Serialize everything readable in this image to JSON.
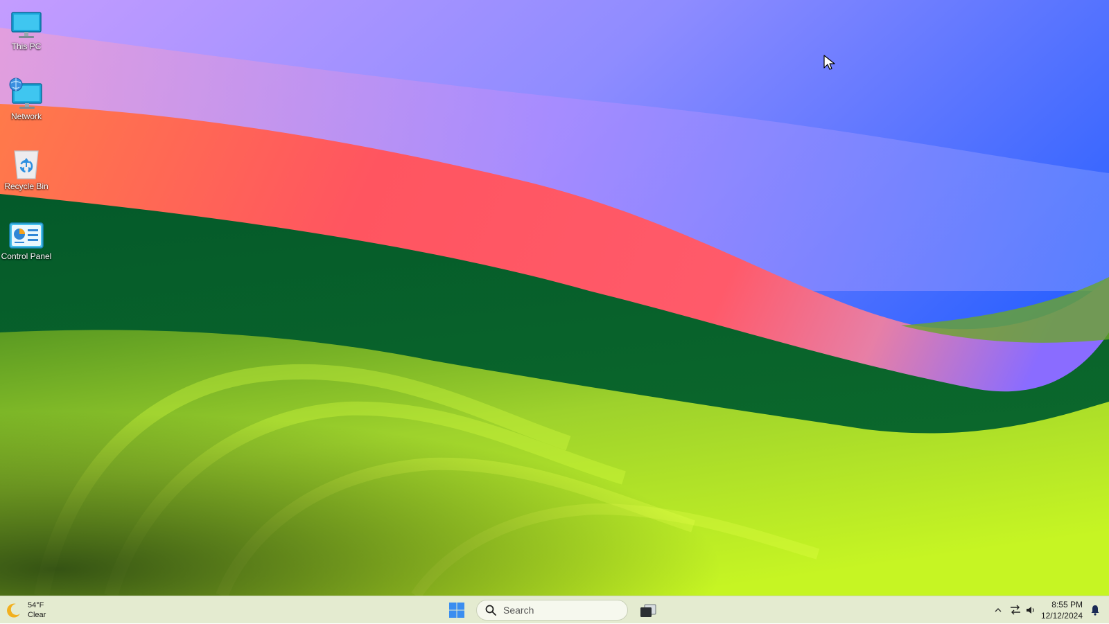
{
  "desktop": {
    "icons": [
      {
        "label": "This PC",
        "icon": "monitor-icon"
      },
      {
        "label": "Network",
        "icon": "network-icon"
      },
      {
        "label": "Recycle Bin",
        "icon": "recycle-bin-icon"
      },
      {
        "label": "Control Panel",
        "icon": "control-panel-icon"
      }
    ]
  },
  "taskbar": {
    "weather": {
      "temperature": "54°F",
      "condition": "Clear",
      "icon": "moon-icon"
    },
    "start_icon": "windows-logo-icon",
    "search": {
      "placeholder": "Search",
      "value": "",
      "icon": "search-icon"
    },
    "task_view_icon": "task-view-icon",
    "tray": {
      "chevron_icon": "chevron-up-icon",
      "network_icon": "network-status-icon",
      "volume_icon": "speaker-icon",
      "notification_icon": "bell-icon"
    },
    "clock": {
      "time": "8:55 PM",
      "date": "12/12/2024"
    }
  },
  "colors": {
    "taskbar_bg": "#e4ebd0",
    "sky_blue": "#1e62ff",
    "ribbon_red": "#ff5a5a",
    "hill_green": "#0a5a2a",
    "meadow_lime": "#b6f02c",
    "start_blue": "#3a8ef0"
  }
}
